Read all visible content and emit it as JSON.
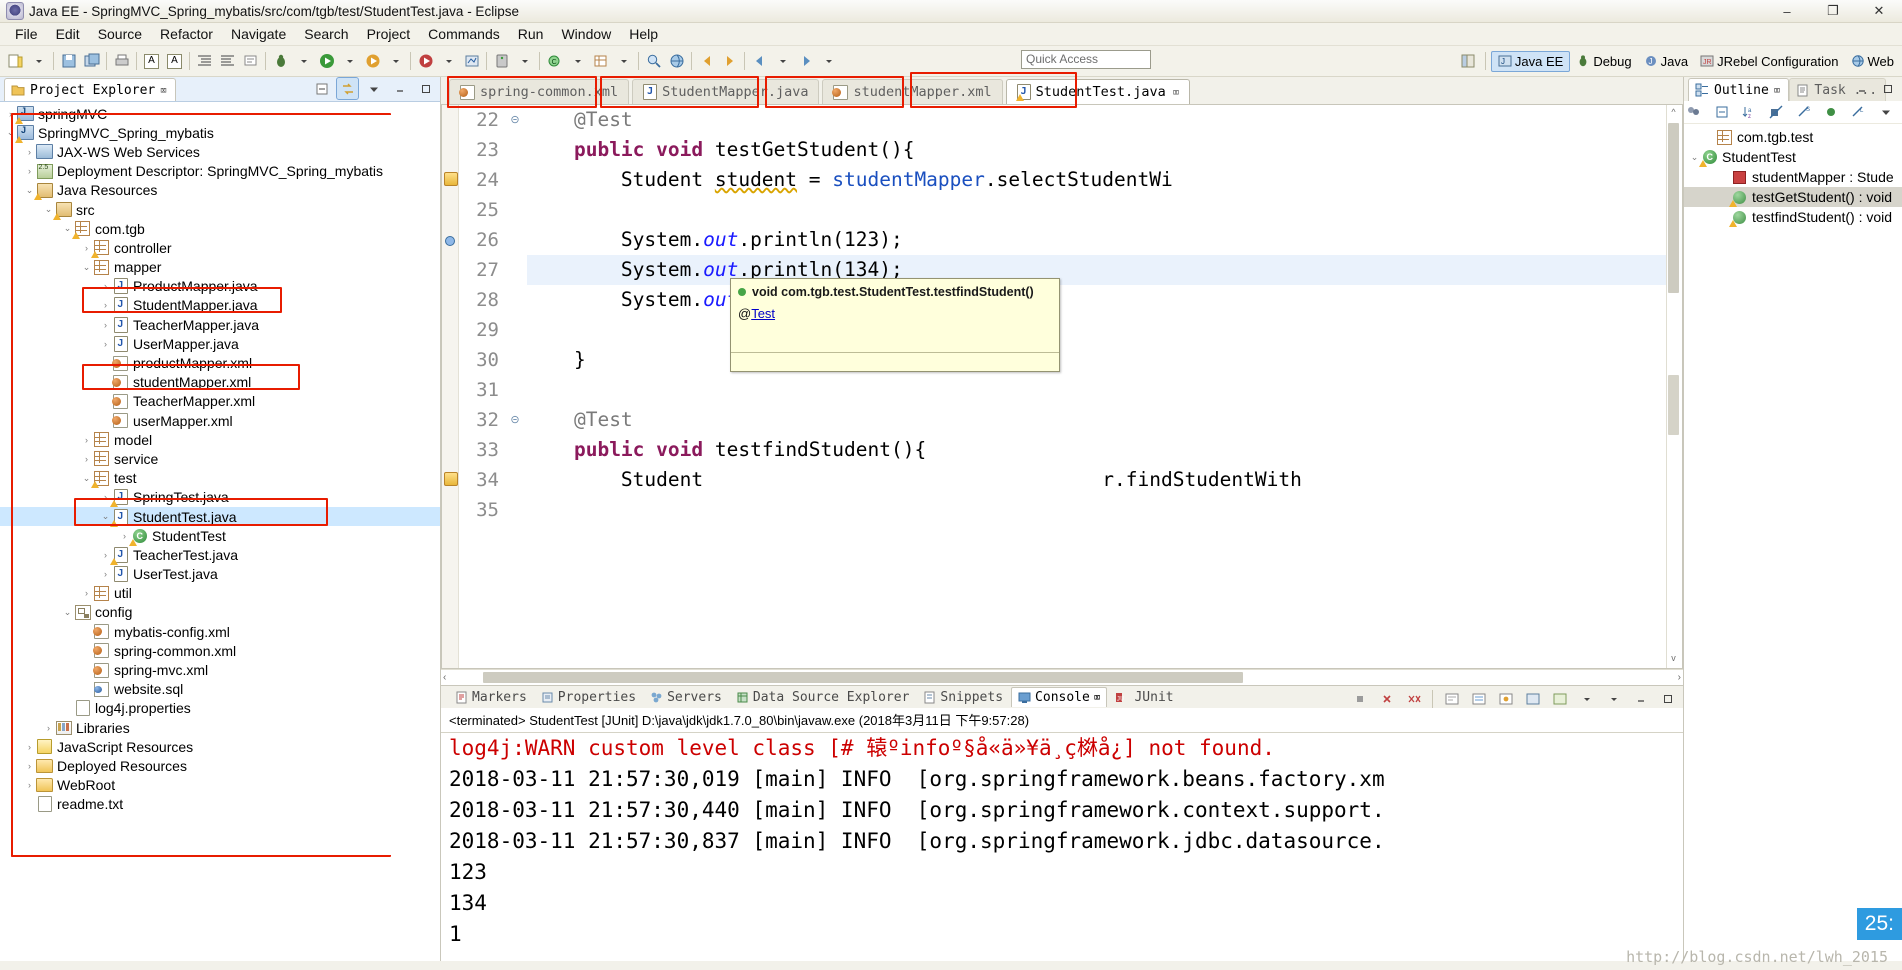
{
  "window": {
    "title": "Java EE - SpringMVC_Spring_mybatis/src/com/tgb/test/StudentTest.java - Eclipse",
    "minimize": "–",
    "maximize": "❐",
    "close": "✕"
  },
  "menubar": {
    "items": [
      "File",
      "Edit",
      "Source",
      "Refactor",
      "Navigate",
      "Search",
      "Project",
      "Commands",
      "Run",
      "Window",
      "Help"
    ]
  },
  "toolbar": {
    "quick_access_placeholder": "Quick Access",
    "quick_access_value": "",
    "perspectives": [
      {
        "label": "Java EE",
        "active": true
      },
      {
        "label": "Debug",
        "active": false
      },
      {
        "label": "Java",
        "active": false
      },
      {
        "label": "JRebel Configuration",
        "active": false
      },
      {
        "label": "Web",
        "active": false
      }
    ]
  },
  "project_explorer": {
    "title": "Project Explorer",
    "close_glyph": "⌧",
    "tree": [
      {
        "label": "springMVC",
        "depth": 0,
        "arrow": "›",
        "icon": "ic-proj",
        "warn": true
      },
      {
        "label": "SpringMVC_Spring_mybatis",
        "depth": 0,
        "arrow": "⌄",
        "icon": "ic-proj",
        "warn": true
      },
      {
        "label": "JAX-WS Web Services",
        "depth": 1,
        "arrow": "›",
        "icon": "ic-jax"
      },
      {
        "label": "Deployment Descriptor: SpringMVC_Spring_mybatis",
        "depth": 1,
        "arrow": "›",
        "icon": "ic-deploy"
      },
      {
        "label": "Java Resources",
        "depth": 1,
        "arrow": "⌄",
        "icon": "ic-pkgroot",
        "warn": true
      },
      {
        "label": "src",
        "depth": 2,
        "arrow": "⌄",
        "icon": "ic-pkgroot",
        "warn": true
      },
      {
        "label": "com.tgb",
        "depth": 3,
        "arrow": "⌄",
        "icon": "ic-pkg",
        "warn": true
      },
      {
        "label": "controller",
        "depth": 4,
        "arrow": "›",
        "icon": "ic-pkg",
        "warn": true
      },
      {
        "label": "mapper",
        "depth": 4,
        "arrow": "⌄",
        "icon": "ic-pkg"
      },
      {
        "label": "ProductMapper.java",
        "depth": 5,
        "arrow": "›",
        "icon": "ic-java"
      },
      {
        "label": "StudentMapper.java",
        "depth": 5,
        "arrow": "›",
        "icon": "ic-java"
      },
      {
        "label": "TeacherMapper.java",
        "depth": 5,
        "arrow": "›",
        "icon": "ic-java"
      },
      {
        "label": "UserMapper.java",
        "depth": 5,
        "arrow": "›",
        "icon": "ic-java"
      },
      {
        "label": "productMapper.xml",
        "depth": 5,
        "arrow": "",
        "icon": "ic-xml"
      },
      {
        "label": "studentMapper.xml",
        "depth": 5,
        "arrow": "",
        "icon": "ic-xml"
      },
      {
        "label": "TeacherMapper.xml",
        "depth": 5,
        "arrow": "",
        "icon": "ic-xml"
      },
      {
        "label": "userMapper.xml",
        "depth": 5,
        "arrow": "",
        "icon": "ic-xml"
      },
      {
        "label": "model",
        "depth": 4,
        "arrow": "›",
        "icon": "ic-pkg"
      },
      {
        "label": "service",
        "depth": 4,
        "arrow": "›",
        "icon": "ic-pkg"
      },
      {
        "label": "test",
        "depth": 4,
        "arrow": "⌄",
        "icon": "ic-pkg",
        "warn": true
      },
      {
        "label": "SpringTest.java",
        "depth": 5,
        "arrow": "›",
        "icon": "ic-java",
        "warn": true
      },
      {
        "label": "StudentTest.java",
        "depth": 5,
        "arrow": "⌄",
        "icon": "ic-java",
        "warn": true,
        "selected": true
      },
      {
        "label": "StudentTest",
        "depth": 6,
        "arrow": "›",
        "icon": "ic-class",
        "warn": true
      },
      {
        "label": "TeacherTest.java",
        "depth": 5,
        "arrow": "›",
        "icon": "ic-java",
        "warn": true
      },
      {
        "label": "UserTest.java",
        "depth": 5,
        "arrow": "›",
        "icon": "ic-java"
      },
      {
        "label": "util",
        "depth": 4,
        "arrow": "›",
        "icon": "ic-pkg"
      },
      {
        "label": "config",
        "depth": 3,
        "arrow": "⌄",
        "icon": "ic-config"
      },
      {
        "label": "mybatis-config.xml",
        "depth": 4,
        "arrow": "",
        "icon": "ic-xml"
      },
      {
        "label": "spring-common.xml",
        "depth": 4,
        "arrow": "",
        "icon": "ic-xml"
      },
      {
        "label": "spring-mvc.xml",
        "depth": 4,
        "arrow": "",
        "icon": "ic-xml"
      },
      {
        "label": "website.sql",
        "depth": 4,
        "arrow": "",
        "icon": "ic-sql"
      },
      {
        "label": "log4j.properties",
        "depth": 3,
        "arrow": "",
        "icon": "ic-txt"
      },
      {
        "label": "Libraries",
        "depth": 2,
        "arrow": "›",
        "icon": "ic-lib"
      },
      {
        "label": "JavaScript Resources",
        "depth": 1,
        "arrow": "›",
        "icon": "ic-js"
      },
      {
        "label": "Deployed Resources",
        "depth": 1,
        "arrow": "›",
        "icon": "ic-folder"
      },
      {
        "label": "WebRoot",
        "depth": 1,
        "arrow": "›",
        "icon": "ic-folder"
      },
      {
        "label": "readme.txt",
        "depth": 1,
        "arrow": "",
        "icon": "ic-txt"
      }
    ]
  },
  "editor": {
    "tabs": [
      {
        "label": "spring-common.xml",
        "icon": "ic-xml",
        "active": false,
        "closable": false
      },
      {
        "label": "StudentMapper.java",
        "icon": "ic-java",
        "active": false,
        "closable": false
      },
      {
        "label": "studentMapper.xml",
        "icon": "ic-xml",
        "active": false,
        "closable": false
      },
      {
        "label": "StudentTest.java",
        "icon": "ic-java",
        "active": true,
        "closable": true,
        "close_glyph": "⌧"
      }
    ],
    "lines": [
      {
        "n": "22",
        "fold": "⊝",
        "html": "    <span class='ann'>@Test</span>"
      },
      {
        "n": "23",
        "fold": "",
        "html": "    <span class='kw'>public</span> <span class='kw'>void</span> testGetStudent(){"
      },
      {
        "n": "24",
        "fold": "",
        "warnmark": true,
        "html": "        Student <span class='warnline'>student</span> = <span class='fld'>studentMapper</span>.selectStudentWi"
      },
      {
        "n": "25",
        "fold": "",
        "html": ""
      },
      {
        "n": "26",
        "fold": "",
        "bp": true,
        "html": "        System.<span class='stat'>out</span>.println(123);"
      },
      {
        "n": "27",
        "fold": "",
        "highlight": true,
        "html": "        System.<span class='stat'>out</span>.println(134);"
      },
      {
        "n": "28",
        "fold": "",
        "html": "        System.<span class='stat'>out</span>.println(1);"
      },
      {
        "n": "29",
        "fold": "",
        "html": ""
      },
      {
        "n": "30",
        "fold": "",
        "html": "    }"
      },
      {
        "n": "31",
        "fold": "",
        "html": ""
      },
      {
        "n": "32",
        "fold": "⊝",
        "html": "    <span class='ann'>@Test</span>"
      },
      {
        "n": "33",
        "fold": "",
        "html": "    <span class='kw'>public</span> <span class='kw'>void</span> testfindStudent(){"
      },
      {
        "n": "34",
        "fold": "",
        "warnmark": true,
        "html": "        Student                                  r.findStudentWith"
      },
      {
        "n": "35",
        "fold": "",
        "html": ""
      }
    ],
    "tooltip": {
      "signature": "void com.tgb.test.StudentTest.testfindStudent()",
      "annotation_prefix": "@",
      "annotation_link": "Test"
    }
  },
  "console_panel": {
    "tabs": [
      {
        "label": "Markers",
        "active": false
      },
      {
        "label": "Properties",
        "active": false
      },
      {
        "label": "Servers",
        "active": false
      },
      {
        "label": "Data Source Explorer",
        "active": false
      },
      {
        "label": "Snippets",
        "active": false
      },
      {
        "label": "Console",
        "active": true,
        "close_glyph": "⌧"
      },
      {
        "label": "JUnit",
        "active": false
      }
    ],
    "terminated_line": "<terminated> StudentTest [JUnit] D:\\java\\jdk\\jdk1.7.0_80\\bin\\javaw.exe (2018年3月11日 下午9:57:28)",
    "output": [
      {
        "text": "log4j:WARN custom level class [# 辕ºinfoº§å«ä»¥ä¸ç棥å¿] not found.",
        "error": true
      },
      {
        "text": "2018-03-11 21:57:30,019 [main] INFO  [org.springframework.beans.factory.xm",
        "error": false
      },
      {
        "text": "2018-03-11 21:57:30,440 [main] INFO  [org.springframework.context.support.",
        "error": false
      },
      {
        "text": "2018-03-11 21:57:30,837 [main] INFO  [org.springframework.jdbc.datasource.",
        "error": false
      },
      {
        "text": "123",
        "error": false
      },
      {
        "text": "134",
        "error": false
      },
      {
        "text": "1",
        "error": false
      }
    ],
    "badge": "25:"
  },
  "outline": {
    "tabs": [
      {
        "label": "Outline",
        "active": true,
        "close_glyph": "⌧"
      },
      {
        "label": "Task ...",
        "active": false
      }
    ],
    "items": [
      {
        "label": "com.tgb.test",
        "depth": 1,
        "arrow": "",
        "icon": "ic-pkg"
      },
      {
        "label": "StudentTest",
        "depth": 0,
        "arrow": "⌄",
        "icon": "ic-class",
        "warn": true
      },
      {
        "label": "studentMapper : Stude",
        "depth": 2,
        "arrow": "",
        "icon": "ic-field"
      },
      {
        "label": "testGetStudent() : void",
        "depth": 2,
        "arrow": "",
        "icon": "ic-method",
        "warn": true,
        "selected": true
      },
      {
        "label": "testfindStudent() : void",
        "depth": 2,
        "arrow": "",
        "icon": "ic-method",
        "warn": true
      }
    ]
  },
  "watermark": "http://blog.csdn.net/lwh_2015"
}
